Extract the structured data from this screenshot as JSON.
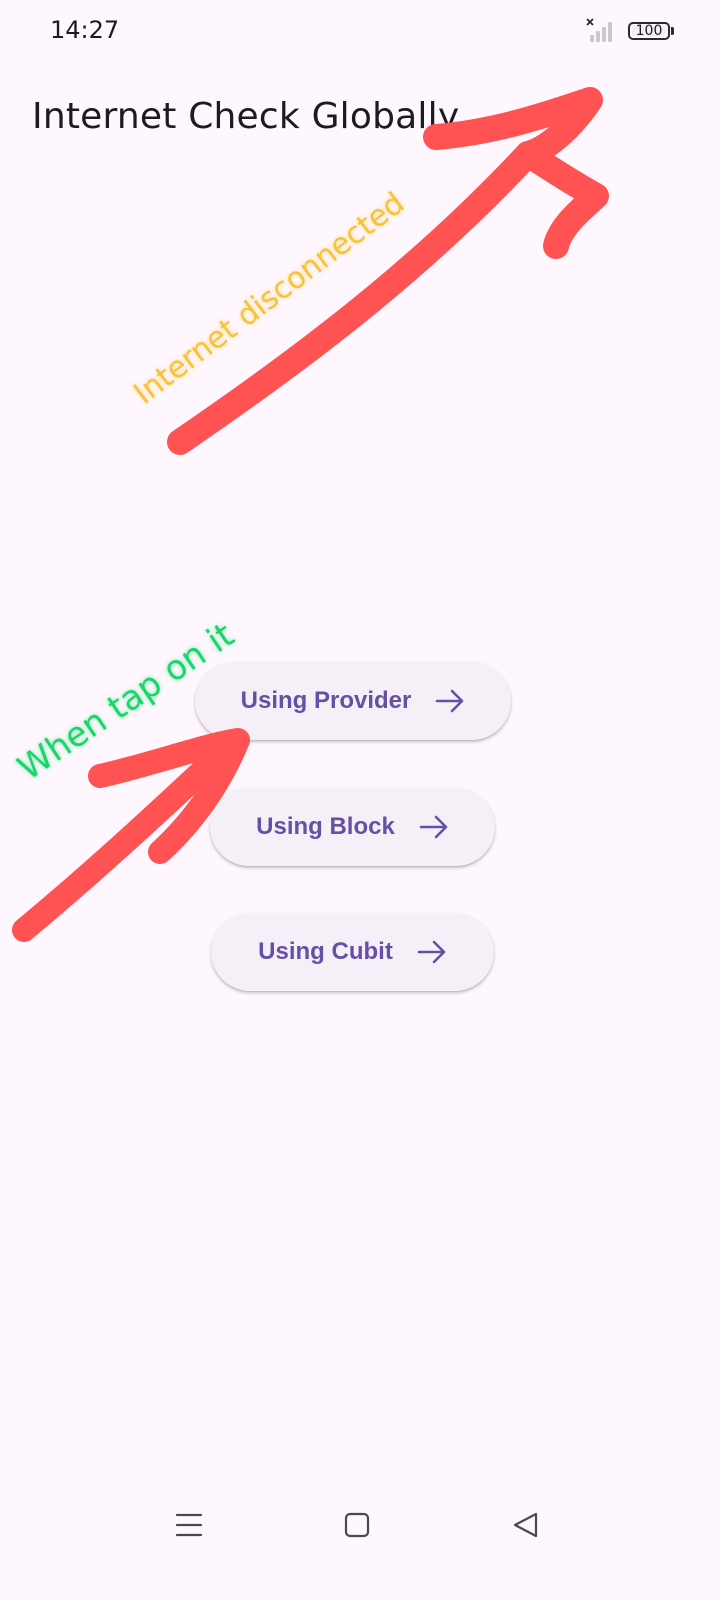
{
  "status_bar": {
    "time": "14:27",
    "battery_level": "100",
    "signal_icon": "signal-off-icon",
    "battery_icon": "battery-icon"
  },
  "app_bar": {
    "title": "Internet Check Globally"
  },
  "buttons": [
    {
      "label": "Using Provider",
      "icon": "arrow-right-icon"
    },
    {
      "label": "Using Block",
      "icon": "arrow-right-icon"
    },
    {
      "label": "Using Cubit",
      "icon": "arrow-right-icon"
    }
  ],
  "annotations": {
    "status_note": "Internet disconnected",
    "tap_note": "When tap on it",
    "note_colors": {
      "status_note": "#F6C33A",
      "tap_note": "#19D66A",
      "arrows": "#FF5252"
    }
  },
  "nav_bar": {
    "icons": [
      "menu-icon",
      "home-square-icon",
      "back-triangle-icon"
    ]
  },
  "colors": {
    "background": "#FEF7FD",
    "button_bg": "#F5F0F8",
    "accent": "#6750A4"
  }
}
